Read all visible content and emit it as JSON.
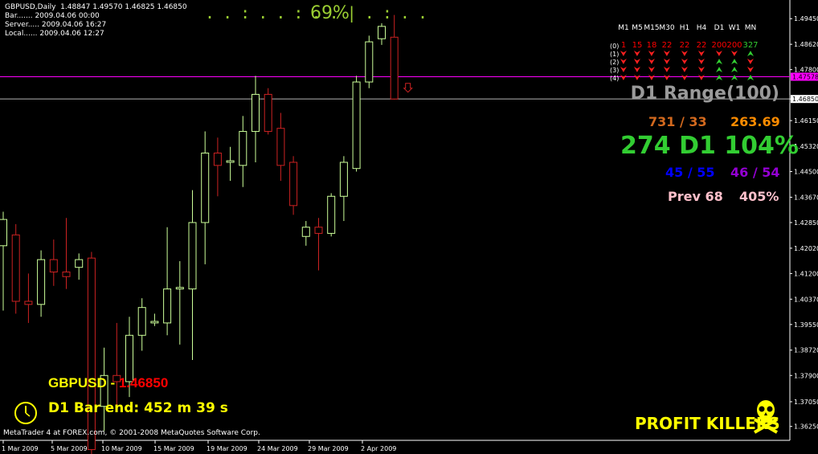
{
  "info": {
    "line1": "GBPUSD,Daily  1.48847 1.49570 1.46825 1.46850",
    "line2": "Bar....... 2009.04.06 00:00",
    "line3": "Server..... 2009.04.06 16:27",
    "line4": "Local...... 2009.04.06 12:27"
  },
  "progress": {
    "dots": ". . : . . : . . | . : . .",
    "value": 69,
    "label": "69%"
  },
  "timeframes": {
    "headers": [
      "M1",
      "M5",
      "M15",
      "M30",
      "H1",
      "H4",
      "D1",
      "W1",
      "MN"
    ],
    "row_labels": [
      "(0)",
      "(1)",
      "(2)",
      "(3)",
      "(4)"
    ],
    "counts": [
      "1",
      "15",
      "18",
      "22",
      "22",
      "22",
      "200",
      "200",
      "327"
    ],
    "count_colors": [
      "#ff0000",
      "#ff0000",
      "#ff0000",
      "#ff0000",
      "#ff0000",
      "#ff0000",
      "#ff0000",
      "#ff0000",
      "#32cd32"
    ],
    "arrows": [
      [
        "down",
        "down",
        "down",
        "down",
        "down",
        "down",
        "down",
        "down",
        "up"
      ],
      [
        "down",
        "down",
        "down",
        "down",
        "down",
        "down",
        "up",
        "up",
        "down"
      ],
      [
        "down",
        "down",
        "down",
        "down",
        "down",
        "down",
        "up",
        "up",
        "down"
      ],
      [
        "down",
        "down",
        "down",
        "down",
        "down",
        "down",
        "up",
        "up",
        "up"
      ]
    ]
  },
  "stats": {
    "range": "D1 Range(100)",
    "row1_left": "731 / 33",
    "row1_right": "263.69",
    "big": "274  D1 104%",
    "row3_left": "45 / 55",
    "row3_right": "46 / 54",
    "row4_left": "Prev 68",
    "row4_right": "405%"
  },
  "bottom": {
    "symbol": "GBPUSD - ",
    "price": "1.46850",
    "bar_end": "D1 Bar end: 452 m 39 s",
    "brand": "PROFIT KILLERS",
    "copyright": "MetaTrader 4 at FOREX.com, © 2001-2008 MetaQuotes Software Corp."
  },
  "colors": {
    "bull": "#ccff99",
    "bear": "#cc2222",
    "line": "#ff00ff",
    "axis": "#ffffff"
  },
  "chart_data": {
    "type": "candlestick",
    "symbol": "GBPUSD",
    "timeframe": "Daily",
    "ylim": [
      1.358,
      1.4995
    ],
    "y_ticks": [
      "1.49450",
      "1.48620",
      "1.47800",
      "1.46850",
      "1.46150",
      "1.45320",
      "1.44500",
      "1.43670",
      "1.42850",
      "1.42020",
      "1.41200",
      "1.40370",
      "1.39550",
      "1.38720",
      "1.37900",
      "1.37050",
      "1.36250"
    ],
    "x_labels": [
      "1 Mar 2009",
      "5 Mar 2009",
      "10 Mar 2009",
      "15 Mar 2009",
      "19 Mar 2009",
      "24 Mar 2009",
      "29 Mar 2009",
      "2 Apr 2009"
    ],
    "hlines": [
      {
        "price": 1.4757,
        "color": "#ff00ff",
        "label": "1.47578"
      },
      {
        "price": 1.4685,
        "color": "#ffffff",
        "label": "1.46850"
      }
    ],
    "candles": [
      {
        "o": 1.421,
        "h": 1.432,
        "l": 1.4,
        "c": 1.4295
      },
      {
        "o": 1.4245,
        "h": 1.428,
        "l": 1.399,
        "c": 1.403
      },
      {
        "o": 1.403,
        "h": 1.412,
        "l": 1.396,
        "c": 1.402
      },
      {
        "o": 1.402,
        "h": 1.4195,
        "l": 1.398,
        "c": 1.4165
      },
      {
        "o": 1.4165,
        "h": 1.423,
        "l": 1.408,
        "c": 1.4125
      },
      {
        "o": 1.4125,
        "h": 1.43,
        "l": 1.407,
        "c": 1.411
      },
      {
        "o": 1.414,
        "h": 1.4185,
        "l": 1.41,
        "c": 1.4165
      },
      {
        "o": 1.417,
        "h": 1.419,
        "l": 1.351,
        "c": 1.355
      },
      {
        "o": 1.369,
        "h": 1.388,
        "l": 1.361,
        "c": 1.379
      },
      {
        "o": 1.379,
        "h": 1.396,
        "l": 1.369,
        "c": 1.377
      },
      {
        "o": 1.377,
        "h": 1.398,
        "l": 1.372,
        "c": 1.392
      },
      {
        "o": 1.392,
        "h": 1.404,
        "l": 1.387,
        "c": 1.401
      },
      {
        "o": 1.396,
        "h": 1.399,
        "l": 1.395,
        "c": 1.3965
      },
      {
        "o": 1.396,
        "h": 1.427,
        "l": 1.392,
        "c": 1.407
      },
      {
        "o": 1.407,
        "h": 1.416,
        "l": 1.389,
        "c": 1.4075
      },
      {
        "o": 1.407,
        "h": 1.439,
        "l": 1.384,
        "c": 1.4285
      },
      {
        "o": 1.4285,
        "h": 1.458,
        "l": 1.415,
        "c": 1.451
      },
      {
        "o": 1.451,
        "h": 1.456,
        "l": 1.437,
        "c": 1.447
      },
      {
        "o": 1.448,
        "h": 1.453,
        "l": 1.442,
        "c": 1.4485
      },
      {
        "o": 1.447,
        "h": 1.463,
        "l": 1.44,
        "c": 1.458
      },
      {
        "o": 1.458,
        "h": 1.476,
        "l": 1.448,
        "c": 1.47
      },
      {
        "o": 1.47,
        "h": 1.472,
        "l": 1.457,
        "c": 1.458
      },
      {
        "o": 1.459,
        "h": 1.464,
        "l": 1.442,
        "c": 1.447
      },
      {
        "o": 1.448,
        "h": 1.45,
        "l": 1.431,
        "c": 1.434
      },
      {
        "o": 1.424,
        "h": 1.429,
        "l": 1.421,
        "c": 1.427
      },
      {
        "o": 1.427,
        "h": 1.43,
        "l": 1.413,
        "c": 1.425
      },
      {
        "o": 1.425,
        "h": 1.438,
        "l": 1.424,
        "c": 1.437
      },
      {
        "o": 1.437,
        "h": 1.45,
        "l": 1.429,
        "c": 1.448
      },
      {
        "o": 1.446,
        "h": 1.476,
        "l": 1.445,
        "c": 1.474
      },
      {
        "o": 1.474,
        "h": 1.489,
        "l": 1.472,
        "c": 1.487
      },
      {
        "o": 1.488,
        "h": 1.493,
        "l": 1.486,
        "c": 1.492
      },
      {
        "o": 1.4885,
        "h": 1.4957,
        "l": 1.4683,
        "c": 1.4685
      }
    ]
  }
}
